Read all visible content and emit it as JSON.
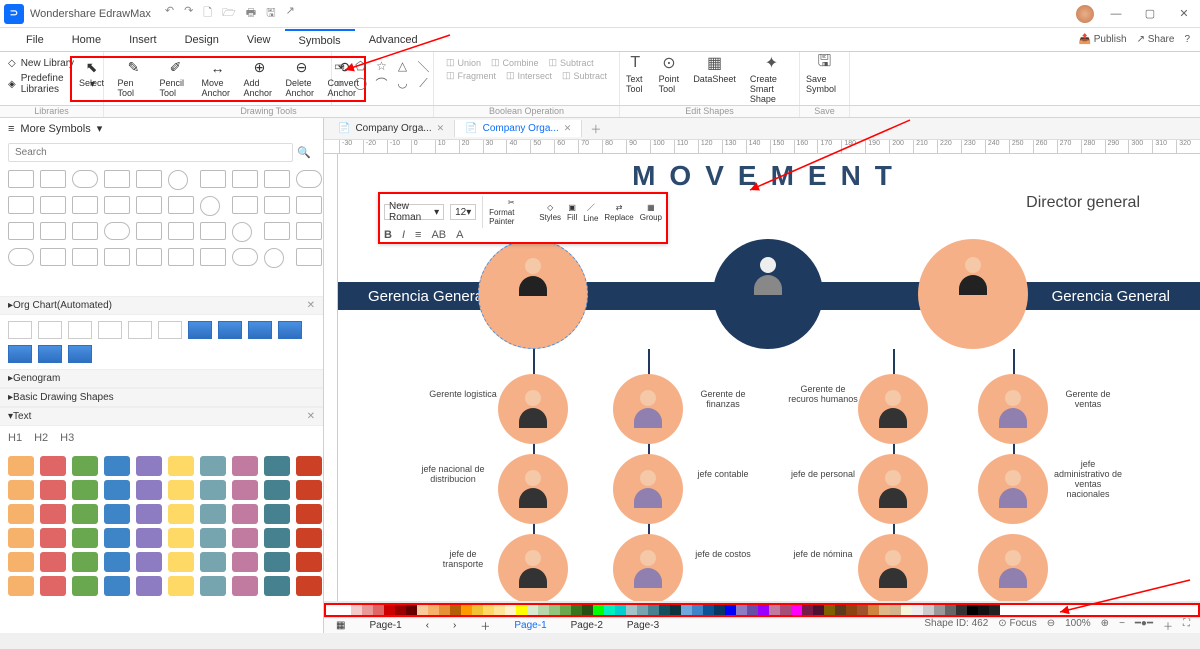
{
  "app": {
    "title": "Wondershare EdrawMax"
  },
  "titlebar": {
    "qat": [
      "↶",
      "↷",
      "🗋",
      "🗁",
      "🖶",
      "🖫",
      "↗"
    ]
  },
  "win": {
    "min": "—",
    "max": "▢",
    "close": "✕"
  },
  "menu": {
    "items": [
      "File",
      "Home",
      "Insert",
      "Design",
      "View",
      "Symbols",
      "Advanced"
    ],
    "active": "Symbols",
    "right": {
      "publish": "Publish",
      "share": "Share",
      "help": "?"
    }
  },
  "ribbon": {
    "left": {
      "newlib": "New Library",
      "predef": "Predefine Libraries"
    },
    "tools": [
      {
        "icon": "⬉",
        "label": "Select"
      },
      {
        "icon": "✎",
        "label": "Pen Tool"
      },
      {
        "icon": "✐",
        "label": "Pencil Tool"
      },
      {
        "icon": "↔",
        "label": "Move Anchor"
      },
      {
        "icon": "⊕",
        "label": "Add Anchor"
      },
      {
        "icon": "⊖",
        "label": "Delete Anchor"
      },
      {
        "icon": "⟲",
        "label": "Convert Anchor"
      }
    ],
    "shapes": [
      "▭",
      "⬠",
      "☆",
      "△",
      "＼",
      "○",
      "◯",
      "⌒",
      "◡",
      "⟋"
    ],
    "bool": {
      "union": "Union",
      "combine": "Combine",
      "subtract": "Subtract",
      "fragment": "Fragment",
      "intersect": "Intersect",
      "subtract2": "Subtract"
    },
    "edit": {
      "text": "Text Tool",
      "point": "Point Tool",
      "datasheet": "DataSheet",
      "smart": "Create Smart Shape",
      "save": "Save Symbol"
    },
    "groups": {
      "libraries": "Libraries",
      "drawing": "Drawing Tools",
      "boolean": "Boolean Operation",
      "editshapes": "Edit Shapes",
      "save": "Save"
    }
  },
  "leftpanel": {
    "header": "More Symbols",
    "search_ph": "Search",
    "sections": {
      "org": "Org Chart(Automated)",
      "geno": "Genogram",
      "basic": "Basic Drawing Shapes",
      "text": "Text"
    },
    "headings": [
      "H1",
      "H2",
      "H3"
    ]
  },
  "doctabs": {
    "tabs": [
      {
        "label": "Company Orga..."
      },
      {
        "label": "Company Orga..."
      }
    ]
  },
  "ruler": [
    "-30",
    "-20",
    "-10",
    "0",
    "10",
    "20",
    "30",
    "40",
    "50",
    "60",
    "70",
    "80",
    "90",
    "100",
    "110",
    "120",
    "130",
    "140",
    "150",
    "160",
    "170",
    "180",
    "190",
    "200",
    "210",
    "220",
    "230",
    "240",
    "250",
    "260",
    "270",
    "280",
    "290",
    "300",
    "310",
    "320"
  ],
  "chart": {
    "title": "MOVEMENT",
    "director": "Director general",
    "band_left": "Gerencia General",
    "band_right": "Gerencia General",
    "roles": {
      "r1": "Gerente logistica",
      "r2": "Gerente de finanzas",
      "r3": "Gerente de recuros humanos",
      "r4": "Gerente de ventas",
      "r5": "jefe nacional de distribucion",
      "r6": "jefe contable",
      "r7": "jefe de personal",
      "r8": "jefe administrativo de ventas nacionales",
      "r9": "jefe de transporte",
      "r10": "jefe de costos",
      "r11": "jefe de nómina"
    }
  },
  "floattb": {
    "font": "New Roman",
    "size": "12",
    "btns": {
      "format": "Format Painter",
      "styles": "Styles",
      "fill": "Fill",
      "line": "Line",
      "replace": "Replace",
      "group": "Group"
    },
    "icons": {
      "bold": "B",
      "italic": "I",
      "align": "≡",
      "aa": "AB",
      "a": "A"
    }
  },
  "status": {
    "shapeid": "Shape ID: 462",
    "focus": "Focus",
    "zoom": "100%"
  },
  "pages": {
    "p1": "Page-1",
    "p2": "Page-2",
    "p3": "Page-3",
    "active": "Page-1"
  },
  "colors": [
    "#fff",
    "#f4cccc",
    "#ea9999",
    "#e06666",
    "#cc0000",
    "#990000",
    "#660000",
    "#f9cb9c",
    "#f6b26b",
    "#e69138",
    "#b45f06",
    "#ff9900",
    "#f1c232",
    "#ffd966",
    "#ffe599",
    "#fff2cc",
    "#ffff00",
    "#d9ead3",
    "#b6d7a8",
    "#93c47d",
    "#6aa84f",
    "#38761d",
    "#274e13",
    "#00ff00",
    "#00f0c0",
    "#00d0d0",
    "#a2c4c9",
    "#76a5af",
    "#45818e",
    "#134f5c",
    "#0c343d",
    "#6fa8dc",
    "#3d85c6",
    "#0b5394",
    "#073763",
    "#0000ff",
    "#8e7cc3",
    "#674ea7",
    "#9900ff",
    "#c27ba0",
    "#a64d79",
    "#ff00ff",
    "#741b47",
    "#4c1130",
    "#7f6000",
    "#5b3a1e",
    "#8b4513",
    "#a0522d",
    "#cd853f",
    "#deb887",
    "#d2b48c",
    "#f5f5dc",
    "#eeeeee",
    "#cccccc",
    "#999999",
    "#666666",
    "#333333",
    "#000000",
    "#111",
    "#222",
    "#fefefe"
  ]
}
